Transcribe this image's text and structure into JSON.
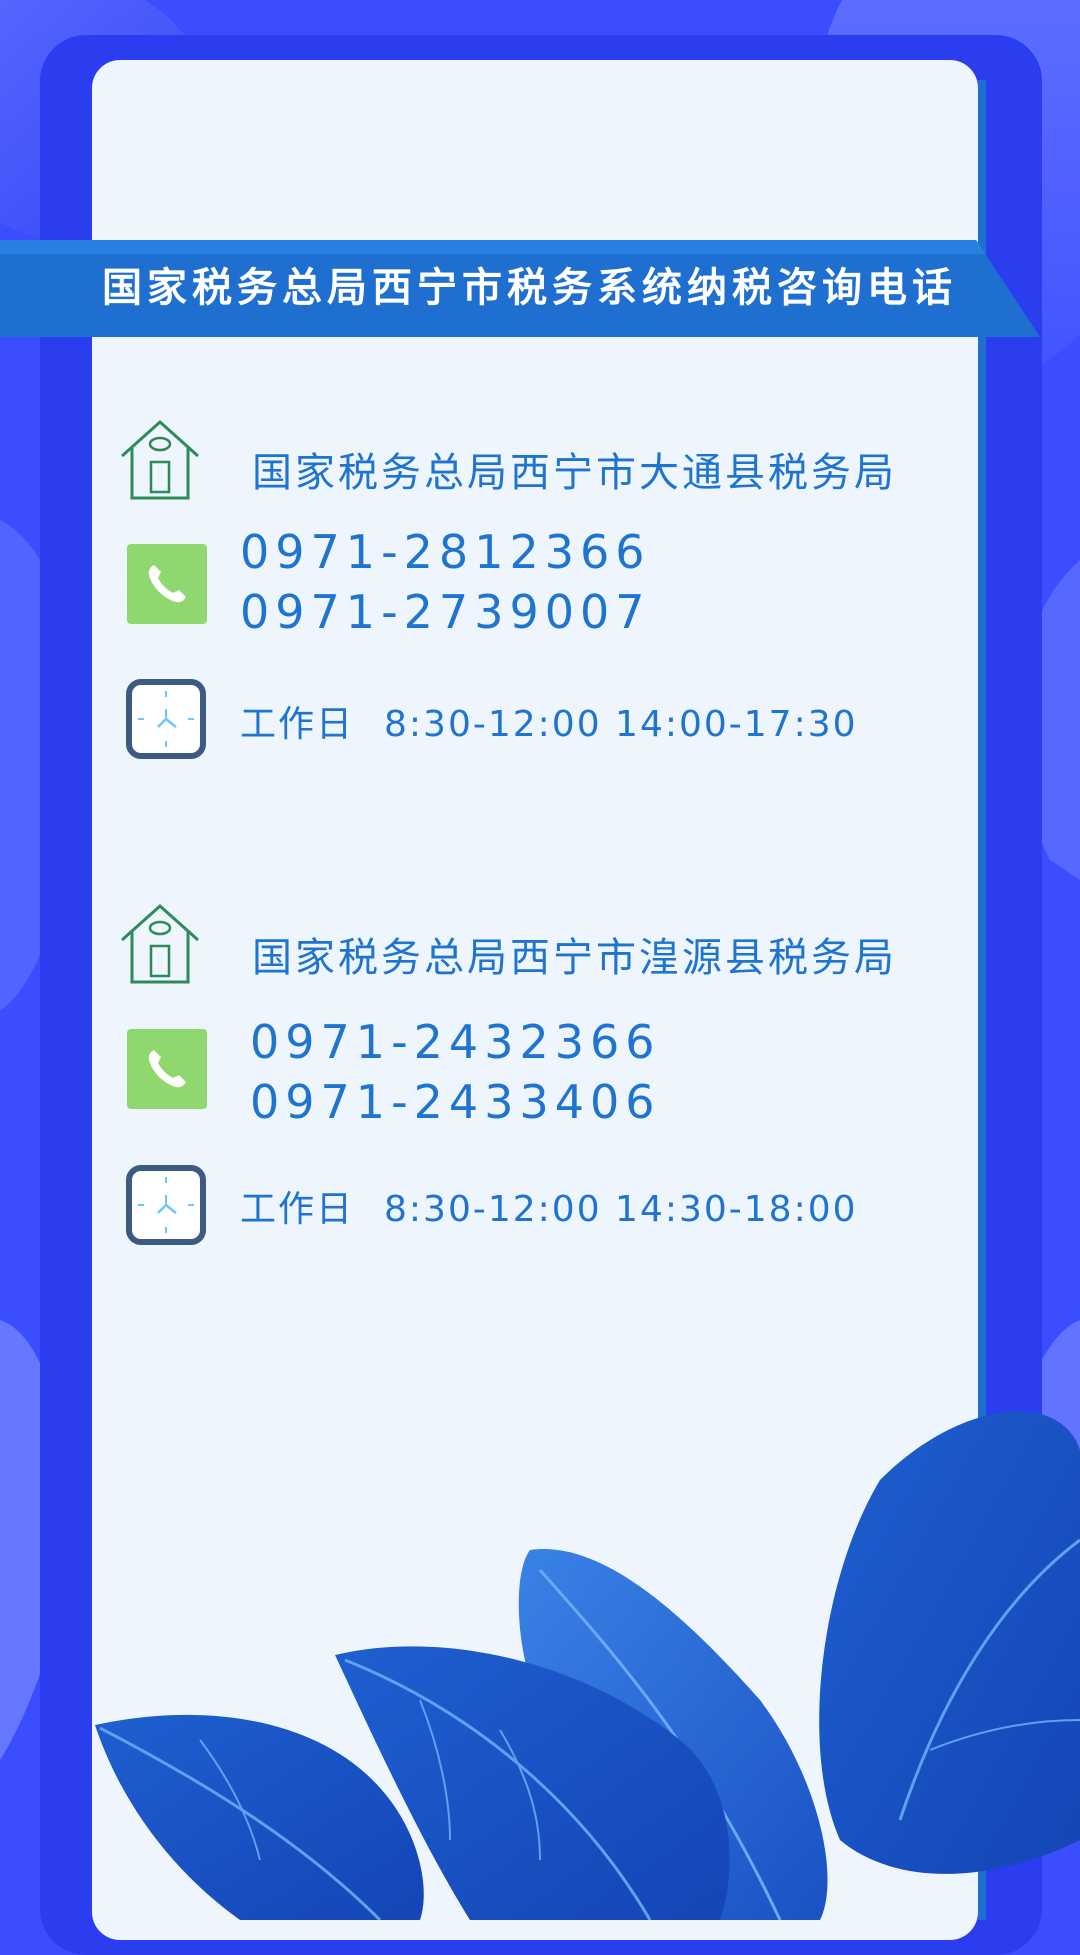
{
  "banner": {
    "title": "国家税务总局西宁市税务系统纳税咨询电话"
  },
  "offices": [
    {
      "name": "国家税务总局西宁市大通县税务局",
      "phones": [
        "0971-2812366",
        "0971-2739007"
      ],
      "hours_label": "工作日",
      "hours": "8:30-12:00 14:00-17:30"
    },
    {
      "name": "国家税务总局西宁市湟源县税务局",
      "phones": [
        "0971-2432366",
        "0971-2433406"
      ],
      "hours_label": "工作日",
      "hours": "8:30-12:00 14:30-18:00"
    }
  ],
  "icons": {
    "house": "house-icon",
    "phone": "phone-icon",
    "clock": "clock-icon"
  },
  "colors": {
    "background": "#3a4dff",
    "card": "#eef5fd",
    "ribbon": "#1e6fd0",
    "text_blue": "#1e74cf",
    "phone_tile": "#8ed86f",
    "house_green": "#2e8b57",
    "clock_frame": "#3d5a80"
  }
}
